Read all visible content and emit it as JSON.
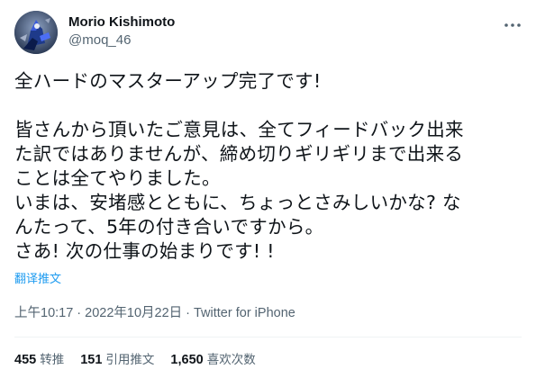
{
  "author": {
    "display_name": "Morio Kishimoto",
    "handle": "@moq_46",
    "avatar_icon": "avatar-illustration"
  },
  "more_icon": "more-dots-icon",
  "tweet": {
    "text": "全ハードのマスターアップ完了です!\n\n皆さんから頂いたご意見は、全てフィードバック出来\nた訳ではありませんが、締め切りギリギリまで出来る\nことは全てやりました。\nいまは、安堵感とともに、ちょっとさみしいかな? な\nんたって、5年の付き合いですから。\nさあ! 次の仕事の始まりです! !",
    "translate_label": "翻译推文"
  },
  "meta": {
    "time": "上午10:17",
    "separator": "·",
    "date": "2022年10月22日",
    "source": "Twitter for iPhone"
  },
  "stats": [
    {
      "count": "455",
      "label": "转推"
    },
    {
      "count": "151",
      "label": "引用推文"
    },
    {
      "count": "1,650",
      "label": "喜欢次数"
    }
  ],
  "colors": {
    "text": "#0f1419",
    "secondary": "#536471",
    "link": "#1d9bf0",
    "divider": "#eff3f4"
  }
}
